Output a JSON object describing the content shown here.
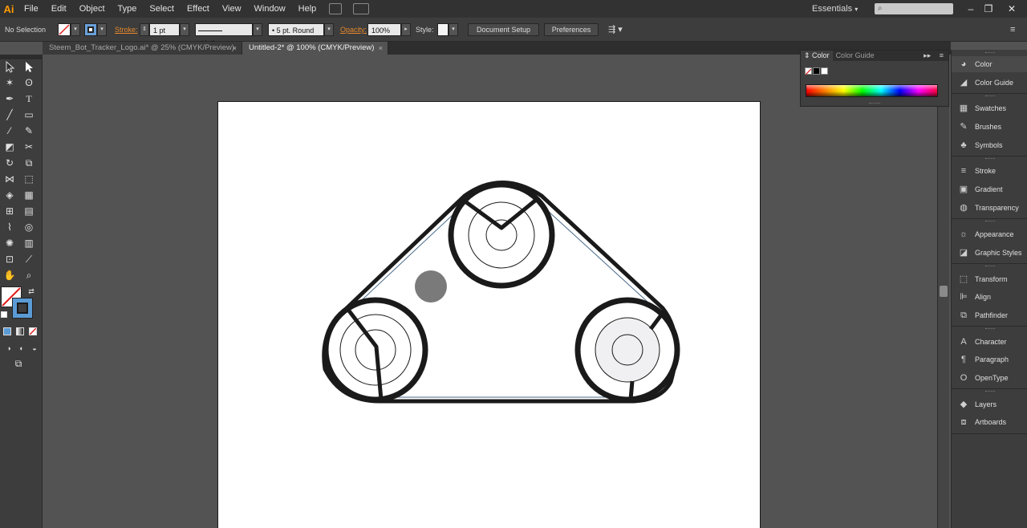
{
  "app": {
    "logo_text": "Ai",
    "accent_color": "#ff9a00"
  },
  "menu": [
    "File",
    "Edit",
    "Object",
    "Type",
    "Select",
    "Effect",
    "View",
    "Window",
    "Help"
  ],
  "workspace": {
    "label": "Essentials",
    "chevron": "▾"
  },
  "window_controls": {
    "minimize": "–",
    "restore": "❐",
    "close": "✕"
  },
  "control_bar": {
    "selection": "No Selection",
    "stroke_label": "Stroke:",
    "stroke_weight": "1 pt",
    "stroke_profile": "Uniform",
    "brush": "5 pt. Round",
    "opacity_label": "Opacity:",
    "opacity_value": "100%",
    "style_label": "Style:",
    "document_setup": "Document Setup",
    "preferences": "Preferences"
  },
  "tabs": [
    {
      "label": "Steem_Bot_Tracker_Logo.ai* @ 25% (CMYK/Preview)",
      "active": false,
      "close": "×"
    },
    {
      "label": "Untitled-2* @ 100% (CMYK/Preview)",
      "active": true,
      "close": "×"
    }
  ],
  "color_panel": {
    "tab_color": "Color",
    "tab_guide": "Color Guide",
    "collapse": "▸▸",
    "menu": "≡"
  },
  "dock": [
    {
      "label": "Color",
      "icon": "color-icon"
    },
    {
      "label": "Color Guide",
      "icon": "color-guide-icon"
    },
    {
      "label": "Swatches",
      "icon": "swatches-icon"
    },
    {
      "label": "Brushes",
      "icon": "brushes-icon"
    },
    {
      "label": "Symbols",
      "icon": "symbols-icon"
    },
    {
      "label": "Stroke",
      "icon": "stroke-icon"
    },
    {
      "label": "Gradient",
      "icon": "gradient-icon"
    },
    {
      "label": "Transparency",
      "icon": "transparency-icon"
    },
    {
      "label": "Appearance",
      "icon": "appearance-icon"
    },
    {
      "label": "Graphic Styles",
      "icon": "graphic-styles-icon"
    },
    {
      "label": "Transform",
      "icon": "transform-icon"
    },
    {
      "label": "Align",
      "icon": "align-icon"
    },
    {
      "label": "Pathfinder",
      "icon": "pathfinder-icon"
    },
    {
      "label": "Character",
      "icon": "character-icon"
    },
    {
      "label": "Paragraph",
      "icon": "paragraph-icon"
    },
    {
      "label": "OpenType",
      "icon": "opentype-icon"
    },
    {
      "label": "Layers",
      "icon": "layers-icon"
    },
    {
      "label": "Artboards",
      "icon": "artboards-icon"
    }
  ],
  "colors": {
    "artwork_stroke": "#1a1a1a",
    "dot_fill": "#7a7a7a",
    "pulley_fill": "#f0f0f2"
  }
}
